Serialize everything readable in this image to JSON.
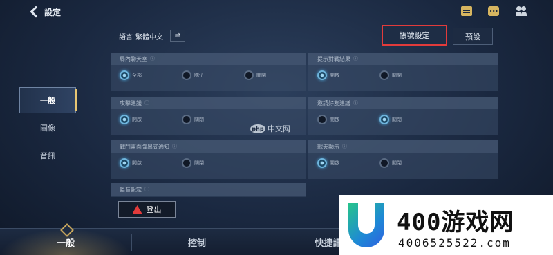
{
  "topbar": {
    "title": "設定",
    "icons": [
      "mail-icon",
      "chat-icon",
      "friends-icon"
    ]
  },
  "language": {
    "label": "語言",
    "value": "繁體中文",
    "swap_icon": "⇌"
  },
  "buttons": {
    "account_settings": "帳號設定",
    "preset": "預設",
    "logout": "登出"
  },
  "sidebar": {
    "items": [
      {
        "label": "一般",
        "active": true
      },
      {
        "label": "圖像",
        "active": false
      },
      {
        "label": "音訊",
        "active": false
      }
    ]
  },
  "settings": {
    "chat_visibility": {
      "label": "局內聊天室",
      "options": [
        "全部",
        "隊伍",
        "關閉"
      ],
      "selected": "全部"
    },
    "show_pairing": {
      "label": "提示對戰結果",
      "options": [
        "開啟",
        "關閉"
      ],
      "selected": "開啟"
    },
    "auto_attack": {
      "label": "攻擊建議",
      "options": [
        "開啟",
        "關閉"
      ],
      "selected": "開啟"
    },
    "friend_invite": {
      "label": "邀請好友建議",
      "options": [
        "開啟",
        "關閉"
      ],
      "selected": "關閉"
    },
    "popup_notice": {
      "label": "戰鬥畫面彈出式通知",
      "options": [
        "開啟",
        "關閉"
      ],
      "selected": "開啟"
    },
    "sky_display": {
      "label": "戰天顯示",
      "options": [
        "開啟",
        "關閉"
      ],
      "selected": "開啟"
    },
    "more": {
      "label": "語音設定"
    }
  },
  "info_glyph": "ⓘ",
  "bottom_tabs": [
    {
      "label": "一般",
      "active": true
    },
    {
      "label": "控制",
      "active": false
    },
    {
      "label": "快捷訊",
      "active": false
    }
  ],
  "watermarks": {
    "php": {
      "badge": "php",
      "text": "中文网"
    },
    "site": {
      "big": "400游戏网",
      "small": "4006525522.com"
    }
  },
  "colors": {
    "accent_gold": "#e8c673",
    "highlight_red": "#e23b3b",
    "radio_on": "#6eb5dd"
  }
}
